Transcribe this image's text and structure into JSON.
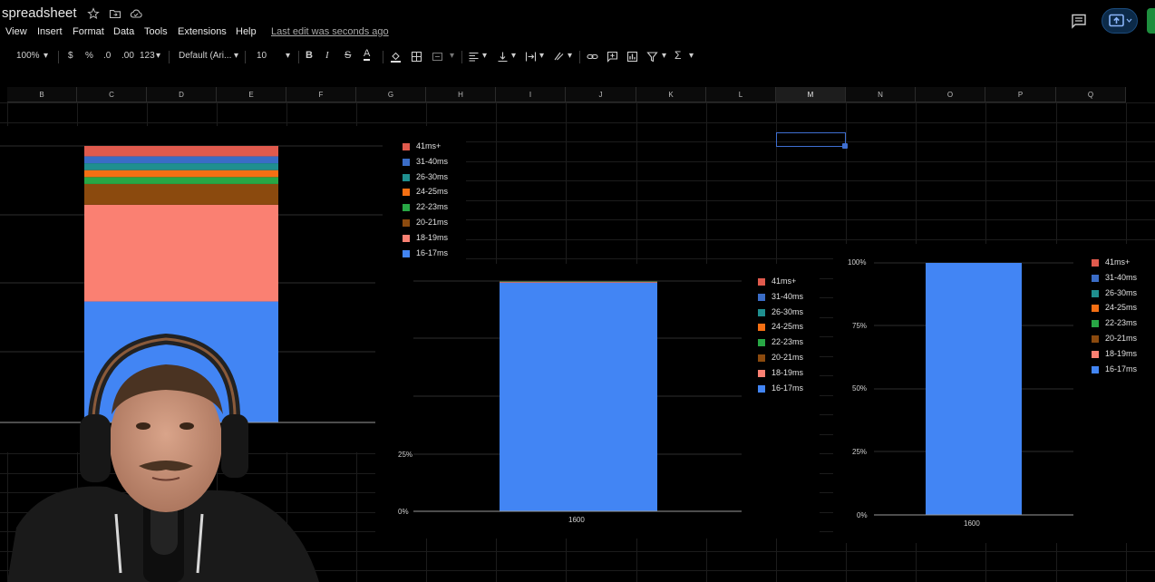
{
  "title_bar": {
    "doc_title": "spreadsheet",
    "icons": [
      "star-icon",
      "folder-icon",
      "cloud-icon",
      "comment-icon",
      "present-icon"
    ]
  },
  "menu": {
    "items": [
      "View",
      "Insert",
      "Format",
      "Data",
      "Tools",
      "Extensions",
      "Help"
    ],
    "last_edit": "Last edit was seconds ago"
  },
  "toolbar": {
    "zoom": "100%",
    "currency": "$",
    "percent": "%",
    "dec_decrease": ".0",
    "dec_increase": ".00",
    "number_format": "123",
    "font": "Default (Ari...",
    "font_size": "10",
    "bold": "B",
    "italic": "I",
    "strike": "S",
    "text_color": "A",
    "sum": "Σ"
  },
  "grid": {
    "columns": [
      "B",
      "C",
      "D",
      "E",
      "F",
      "G",
      "H",
      "I",
      "J",
      "K",
      "L",
      "M",
      "N",
      "O",
      "P",
      "Q"
    ],
    "active_column": "M"
  },
  "colors": {
    "41ms+": "#e05a4d",
    "31-40ms": "#3a6cc6",
    "26-30ms": "#1f8f8f",
    "24-25ms": "#f56f13",
    "22-23ms": "#28a745",
    "20-21ms": "#8b4a0e",
    "18-19ms": "#fa8072",
    "16-17ms": "#4285f4",
    "accent": "#3f6fd1"
  },
  "legend_labels": [
    "41ms+",
    "31-40ms",
    "26-30ms",
    "24-25ms",
    "22-23ms",
    "20-21ms",
    "18-19ms",
    "16-17ms"
  ],
  "chart_data": [
    {
      "type": "bar",
      "stacked": true,
      "series": [
        {
          "name": "16-17ms",
          "values": [
            35
          ]
        },
        {
          "name": "18-19ms",
          "values": [
            28
          ]
        },
        {
          "name": "20-21ms",
          "values": [
            6
          ]
        },
        {
          "name": "22-23ms",
          "values": [
            2
          ]
        },
        {
          "name": "24-25ms",
          "values": [
            2
          ]
        },
        {
          "name": "26-30ms",
          "values": [
            2
          ]
        },
        {
          "name": "31-40ms",
          "values": [
            2
          ]
        },
        {
          "name": "41ms+",
          "values": [
            3
          ]
        }
      ],
      "legend": "right",
      "grid": true
    },
    {
      "type": "bar",
      "stacked": true,
      "categories": [
        "1600"
      ],
      "series": [
        {
          "name": "16-17ms",
          "values": [
            99.3
          ]
        },
        {
          "name": "18-19ms",
          "values": [
            0.3
          ]
        },
        {
          "name": "20-21ms",
          "values": [
            0.1
          ]
        },
        {
          "name": "22-23ms",
          "values": [
            0.1
          ]
        },
        {
          "name": "24-25ms",
          "values": [
            0.1
          ]
        },
        {
          "name": "26-30ms",
          "values": [
            0.1
          ]
        },
        {
          "name": "31-40ms",
          "values": [
            0
          ]
        },
        {
          "name": "41ms+",
          "values": [
            0
          ]
        }
      ],
      "y_ticks": [
        "0%",
        "25%"
      ],
      "ylim": [
        0,
        100
      ],
      "legend": "right",
      "grid": true
    },
    {
      "type": "bar",
      "stacked": true,
      "categories": [
        "1600"
      ],
      "series": [
        {
          "name": "16-17ms",
          "values": [
            100
          ]
        },
        {
          "name": "18-19ms",
          "values": [
            0
          ]
        },
        {
          "name": "20-21ms",
          "values": [
            0
          ]
        },
        {
          "name": "22-23ms",
          "values": [
            0
          ]
        },
        {
          "name": "24-25ms",
          "values": [
            0
          ]
        },
        {
          "name": "26-30ms",
          "values": [
            0
          ]
        },
        {
          "name": "31-40ms",
          "values": [
            0
          ]
        },
        {
          "name": "41ms+",
          "values": [
            0
          ]
        }
      ],
      "y_ticks": [
        "0%",
        "25%",
        "50%",
        "75%",
        "100%"
      ],
      "ylim": [
        0,
        100
      ],
      "legend": "right",
      "grid": true
    }
  ]
}
